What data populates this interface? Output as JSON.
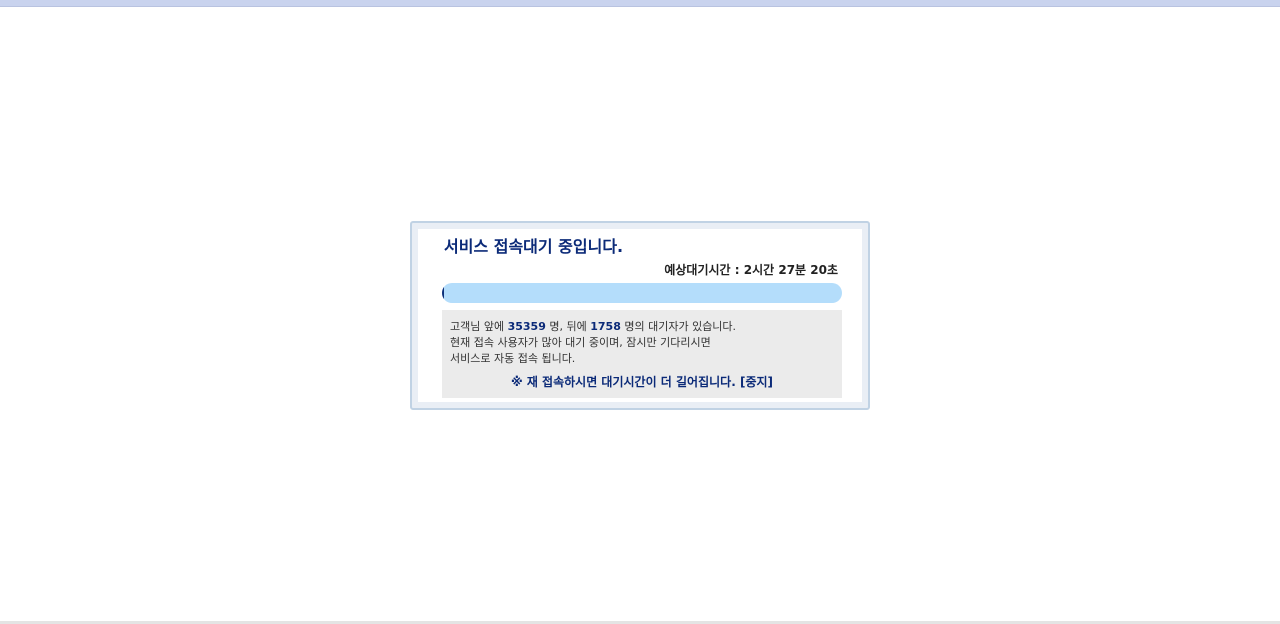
{
  "dialog": {
    "title": "서비스 접속대기 중입니다.",
    "eta_label": "예상대기시간 : ",
    "eta_value": "2시간 27분 20초",
    "progress": 0.005,
    "line1_prefix": "고객님 앞에 ",
    "ahead_count": "35359",
    "line1_mid": " 명, 뒤에 ",
    "behind_count": "1758",
    "line1_suffix": " 명의 대기자가 있습니다.",
    "line2": "현재 접속 사용자가 많아 대기 중이며, 잠시만 기다리시면",
    "line3": "서비스로 자동 접속 됩니다.",
    "warning": "※ 재 접속하시면 대기시간이 더 길어집니다. ",
    "stop_label": "[중지]"
  },
  "colors": {
    "title": "#0b2a78",
    "progress_track": "#b4ddfb",
    "progress_fill": "#0d2f79",
    "info_bg": "#ebebeb"
  }
}
